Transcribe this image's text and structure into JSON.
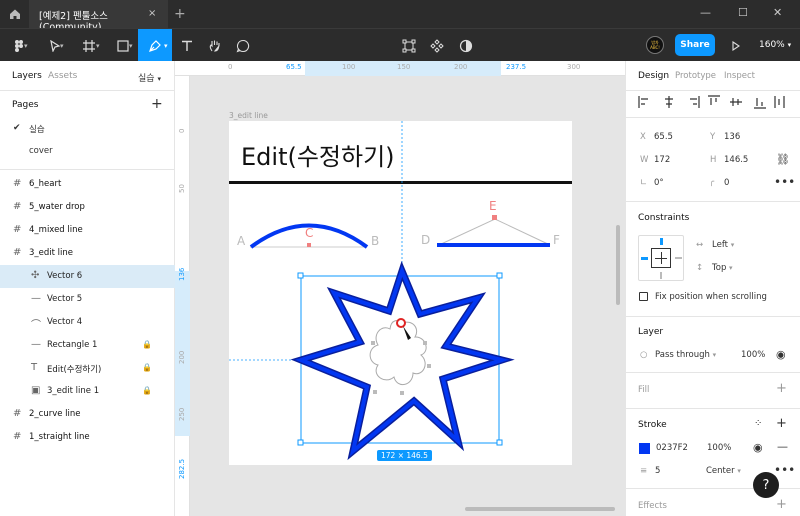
{
  "window": {
    "tab_title": "[예제2] 펜툴소스 (Community)",
    "tab_close": "×",
    "new_tab": "+",
    "minimize": "—",
    "maximize": "☐",
    "close": "✕"
  },
  "toolbar": {
    "share_label": "Share",
    "zoom_label": "160%",
    "avatar_text": "밤차 ABC!"
  },
  "left_panel": {
    "tab_layers": "Layers",
    "tab_assets": "Assets",
    "page_switch": "실습",
    "pages_title": "Pages",
    "pages_add": "+",
    "pages": [
      {
        "label": "실습",
        "current": true
      },
      {
        "label": "cover",
        "current": false
      }
    ],
    "layers": [
      {
        "label": "6_heart",
        "type": "frame"
      },
      {
        "label": "5_water drop",
        "type": "frame"
      },
      {
        "label": "4_mixed line",
        "type": "frame"
      },
      {
        "label": "3_edit line",
        "type": "frame"
      },
      {
        "label": "Vector 6",
        "type": "vector-edit",
        "selected": true
      },
      {
        "label": "Vector 5",
        "type": "line"
      },
      {
        "label": "Vector 4",
        "type": "curve"
      },
      {
        "label": "Rectangle 1",
        "type": "rect",
        "locked": true
      },
      {
        "label": "Edit(수정하기)",
        "type": "text",
        "locked": true
      },
      {
        "label": "3_edit line 1",
        "type": "image",
        "locked": true
      },
      {
        "label": "2_curve line",
        "type": "frame"
      },
      {
        "label": "1_straight line",
        "type": "frame"
      }
    ]
  },
  "canvas": {
    "ruler_top": [
      {
        "label": "0",
        "hl": false
      },
      {
        "label": "65.5",
        "hl": true
      },
      {
        "label": "100",
        "hl": false
      },
      {
        "label": "150",
        "hl": false
      },
      {
        "label": "200",
        "hl": false
      },
      {
        "label": "237.5",
        "hl": true
      },
      {
        "label": "300",
        "hl": false
      }
    ],
    "ruler_left": [
      {
        "label": "0",
        "hl": false
      },
      {
        "label": "50",
        "hl": false
      },
      {
        "label": "136",
        "hl": true
      },
      {
        "label": "200",
        "hl": false
      },
      {
        "label": "250",
        "hl": false
      },
      {
        "label": "282.5",
        "hl": true
      }
    ],
    "frame_label": "3_edit line",
    "frame_title": "Edit(수정하기)",
    "point_labels": {
      "a": "A",
      "b": "B",
      "c": "C",
      "d": "D",
      "e": "E",
      "f": "F"
    },
    "size_badge": "172 × 146.5"
  },
  "right_panel": {
    "tabs": {
      "design": "Design",
      "prototype": "Prototype",
      "inspect": "Inspect"
    },
    "x_label": "X",
    "x_value": "65.5",
    "y_label": "Y",
    "y_value": "136",
    "w_label": "W",
    "w_value": "172",
    "h_label": "H",
    "h_value": "146.5",
    "rotation": "0°",
    "radius": "0",
    "constraints_title": "Constraints",
    "constraint_h": "Left",
    "constraint_v": "Top",
    "fix_position": "Fix position when scrolling",
    "layer_title": "Layer",
    "blend_mode": "Pass through",
    "layer_opacity": "100%",
    "fill_title": "Fill",
    "stroke_title": "Stroke",
    "stroke_color": "0237F2",
    "stroke_color_hex": "#0237F2",
    "stroke_opacity": "100%",
    "stroke_weight": "5",
    "stroke_align": "Center",
    "effects_title": "Effects",
    "help": "?"
  },
  "colors": {
    "accent": "#0d99ff",
    "stroke_blue": "#0237F2",
    "point_red": "#f08080"
  }
}
